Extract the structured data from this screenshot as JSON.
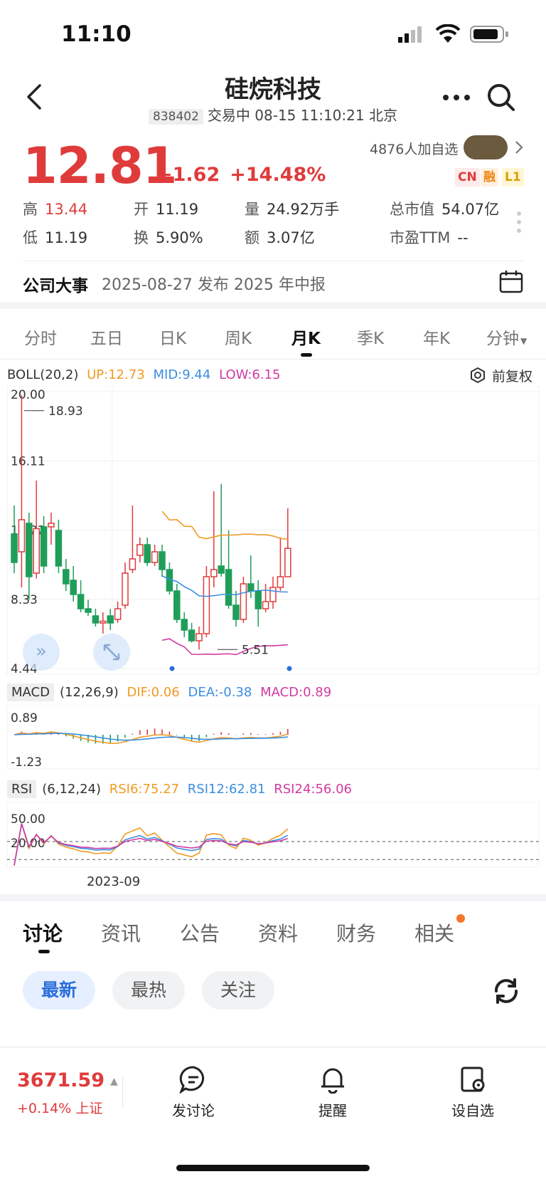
{
  "status_bar": {
    "time": "11:10"
  },
  "header": {
    "title": "硅烷科技",
    "code": "838402",
    "trading_info": "交易中 08-15 11:10:21 北京"
  },
  "quote": {
    "price": "12.81",
    "change": "+1.62",
    "change_pct": "+14.48%",
    "watchers": "4876人加自选",
    "tags": [
      "CN",
      "融",
      "L1"
    ],
    "stats": [
      {
        "label": "高",
        "value": "13.44",
        "red": true
      },
      {
        "label": "开",
        "value": "11.19"
      },
      {
        "label": "量",
        "value": "24.92万手"
      },
      {
        "label": "总市值",
        "value": "54.07亿"
      },
      {
        "label": "低",
        "value": "11.19"
      },
      {
        "label": "换",
        "value": "5.90%"
      },
      {
        "label": "额",
        "value": "3.07亿"
      },
      {
        "label": "市盈TTM",
        "value": "--"
      }
    ]
  },
  "company_event": {
    "label": "公司大事",
    "text": "2025-08-27 发布 2025 年中报"
  },
  "chart_tabs": [
    "分时",
    "五日",
    "日K",
    "周K",
    "月K",
    "季K",
    "年K",
    "分钟"
  ],
  "chart_tab_active": 4,
  "boll": {
    "name": "BOLL(20,2)",
    "up": "UP:12.73",
    "mid": "MID:9.44",
    "low": "LOW:6.15",
    "adjust": "前复权"
  },
  "macd": {
    "name": "MACD",
    "params": "(12,26,9)",
    "dif": "DIF:0.06",
    "dea": "DEA:-0.38",
    "macd": "MACD:0.89"
  },
  "rsi": {
    "name": "RSI",
    "params": "(6,12,24)",
    "rsi6": "RSI6:75.27",
    "rsi12": "RSI12:62.81",
    "rsi24": "RSI24:56.06"
  },
  "chart_data": {
    "type": "candlestick",
    "y_ticks": [
      "20.00",
      "16.11",
      "12.22",
      "8.33",
      "4.44"
    ],
    "ylim": [
      4.44,
      20.0
    ],
    "max_marker": "18.93",
    "min_marker": "5.51",
    "x_tick": "2023-09",
    "macd_ticks": [
      "0.89",
      "-1.23"
    ],
    "rsi_ticks": [
      "50.00",
      "20.00"
    ],
    "candles": [
      [
        12.0,
        10.4,
        13.6,
        9.8
      ],
      [
        11.0,
        12.8,
        19.8,
        9.0
      ],
      [
        12.6,
        9.6,
        13.2,
        8.3
      ],
      [
        9.8,
        12.3,
        15.0,
        9.5
      ],
      [
        12.4,
        10.2,
        13.0,
        9.8
      ],
      [
        12.4,
        12.6,
        13.2,
        11.4
      ],
      [
        12.2,
        10.2,
        12.8,
        9.8
      ],
      [
        10.0,
        9.2,
        10.6,
        8.8
      ],
      [
        9.4,
        8.6,
        10.2,
        8.2
      ],
      [
        8.6,
        7.8,
        9.4,
        7.6
      ],
      [
        7.8,
        7.6,
        8.3,
        7.4
      ],
      [
        7.4,
        7.0,
        7.8,
        6.8
      ],
      [
        7.0,
        7.1,
        7.6,
        6.4
      ],
      [
        7.4,
        7.0,
        7.8,
        6.6
      ],
      [
        7.2,
        7.8,
        8.2,
        7.0
      ],
      [
        8.0,
        9.8,
        10.4,
        7.8
      ],
      [
        10.0,
        10.6,
        13.6,
        9.8
      ],
      [
        10.8,
        11.4,
        11.8,
        10.4
      ],
      [
        11.4,
        10.4,
        11.8,
        10.2
      ],
      [
        10.4,
        11.0,
        11.4,
        10.2
      ],
      [
        11.0,
        10.0,
        11.4,
        9.6
      ],
      [
        10.0,
        8.8,
        10.4,
        8.6
      ],
      [
        8.8,
        7.2,
        9.2,
        7.0
      ],
      [
        7.2,
        6.6,
        7.6,
        6.2
      ],
      [
        6.6,
        6.0,
        7.0,
        5.9
      ],
      [
        6.0,
        6.4,
        6.8,
        5.5
      ],
      [
        6.4,
        9.6,
        10.2,
        6.2
      ],
      [
        9.6,
        10.0,
        14.4,
        9.0
      ],
      [
        10.2,
        9.8,
        14.8,
        9.6
      ],
      [
        10.0,
        8.0,
        12.2,
        7.8
      ],
      [
        8.0,
        7.2,
        8.8,
        6.8
      ],
      [
        7.2,
        9.2,
        9.6,
        7.0
      ],
      [
        9.2,
        8.8,
        10.8,
        8.4
      ],
      [
        8.8,
        7.8,
        9.4,
        6.8
      ],
      [
        7.8,
        8.2,
        9.2,
        7.6
      ],
      [
        8.2,
        9.0,
        9.6,
        7.8
      ],
      [
        9.0,
        9.6,
        11.8,
        8.8
      ],
      [
        9.6,
        11.19,
        13.44,
        11.19
      ]
    ]
  },
  "bottom_tabs": [
    "讨论",
    "资讯",
    "公告",
    "资料",
    "财务",
    "相关"
  ],
  "bottom_tab_active": 0,
  "chips": [
    "最新",
    "最热",
    "关注"
  ],
  "bottom_bar": {
    "index_value": "3671.59",
    "index_change": "+0.14%",
    "index_name": "上证",
    "actions": [
      "发讨论",
      "提醒",
      "设自选"
    ]
  },
  "colors": {
    "up": "#e03b3b",
    "down": "#1f9e5a",
    "accent": "#2a6fdb",
    "boll_up": "#f09a23",
    "boll_mid": "#3b8ee0",
    "boll_low": "#d13aa1"
  }
}
